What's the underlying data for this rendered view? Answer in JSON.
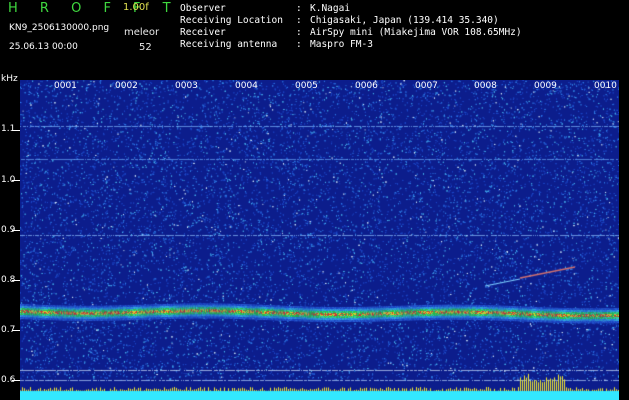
{
  "app": {
    "logo": "H R O F F T",
    "version": "1.00f",
    "filename": "KN9_2506130000.png",
    "timestamp": "25.06.13 00:00",
    "control_label": "meleor",
    "count": "52"
  },
  "info": [
    {
      "key": "Observer",
      "value": "K.Nagai"
    },
    {
      "key": "Receiving Location",
      "value": "Chigasaki, Japan (139.414 35.340)"
    },
    {
      "key": "Receiver",
      "value": "AirSpy mini (Miakejima VOR 108.65MHz)"
    },
    {
      "key": "Receiving antenna",
      "value": "Maspro FM-3"
    }
  ],
  "chart_data": {
    "type": "heatmap",
    "ylabel": "kHz",
    "yticks": [
      "1.1",
      "1.0",
      "0.9",
      "0.8",
      "0.7",
      "0.6"
    ],
    "xticks": [
      "0001",
      "0002",
      "0003",
      "0004",
      "0005",
      "0006",
      "0007",
      "0008",
      "0009",
      "0010"
    ],
    "colors": {
      "background": "#0c1d8c",
      "signal": "#2ac84a",
      "peak": "#e03030",
      "noise_floor": "#33e8ff"
    }
  }
}
